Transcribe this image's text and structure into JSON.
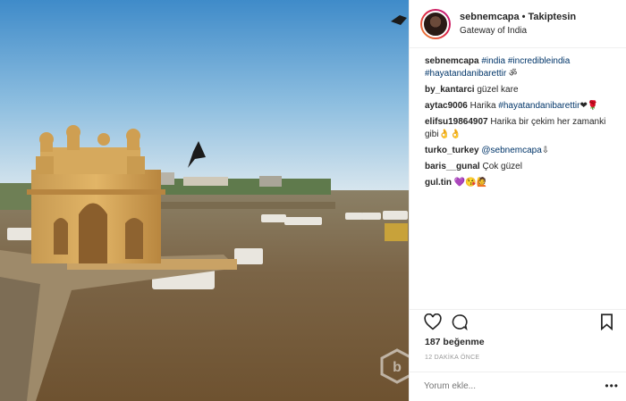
{
  "post": {
    "username": "sebnemcapa",
    "follow_label": "Takiptesin",
    "location": "Gateway of India"
  },
  "caption": {
    "username": "sebnemcapa",
    "hashtags": "#india #incredibleindia #hayatandanibarettir",
    "suffix": "ॐ"
  },
  "comments": [
    {
      "user": "by_kantarci",
      "text": "güzel kare"
    },
    {
      "user": "aytac9006",
      "text": "Harika",
      "tag": "#hayatandanibarettir",
      "emoji": "❤🌹"
    },
    {
      "user": "elifsu19864907",
      "text": "Harika bir çekim her zamanki gibi👌👌"
    },
    {
      "user": "turko_turkey",
      "tag": "@sebnemcapa",
      "emoji": "⇩"
    },
    {
      "user": "baris__gunal",
      "text": "Çok güzel"
    },
    {
      "user": "gul.tin",
      "emoji": "💜😘🙋"
    }
  ],
  "likes": "187 beğenme",
  "time_ago": "12 DAKİKA ÖNCE",
  "comment_placeholder": "Yorum ekle...",
  "more_label": "•••",
  "icons": {
    "like": "heart-icon",
    "comment": "comment-icon",
    "save": "bookmark-icon"
  },
  "colors": {
    "link": "#003569",
    "text": "#262626",
    "muted": "#999999"
  }
}
